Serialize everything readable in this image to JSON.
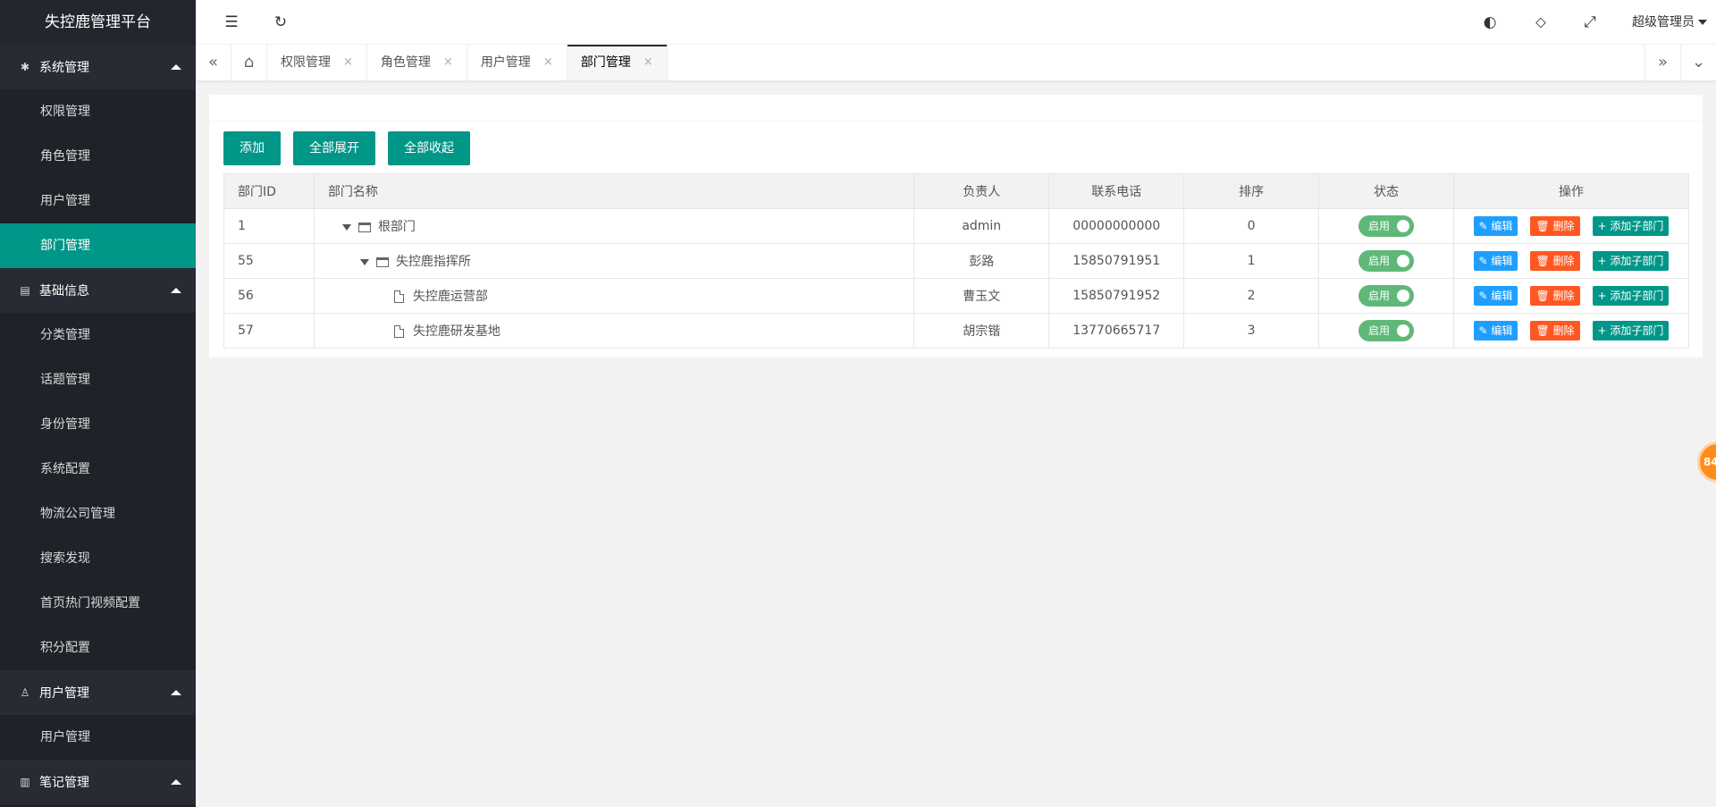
{
  "app_title": "失控鹿管理平台",
  "sidebar": {
    "groups": [
      {
        "label": "系统管理",
        "icon": "gear-icon",
        "items": [
          "权限管理",
          "角色管理",
          "用户管理",
          "部门管理"
        ],
        "active": "部门管理"
      },
      {
        "label": "基础信息",
        "icon": "document-icon",
        "items": [
          "分类管理",
          "话题管理",
          "身份管理",
          "系统配置",
          "物流公司管理",
          "搜索发现",
          "首页热门视频配置",
          "积分配置"
        ]
      },
      {
        "label": "用户管理",
        "icon": "person-icon",
        "items": [
          "用户管理"
        ]
      },
      {
        "label": "笔记管理",
        "icon": "book-icon",
        "items": []
      }
    ]
  },
  "header": {
    "user_name": "超级管理员"
  },
  "tabs": [
    {
      "label": "权限管理"
    },
    {
      "label": "角色管理"
    },
    {
      "label": "用户管理"
    },
    {
      "label": "部门管理",
      "active": true
    }
  ],
  "toolbar": {
    "add_label": "添加",
    "expand_label": "全部展开",
    "collapse_label": "全部收起"
  },
  "table": {
    "columns": [
      "部门ID",
      "部门名称",
      "负责人",
      "联系电话",
      "排序",
      "状态",
      "操作"
    ],
    "rows": [
      {
        "id": "1",
        "name": "根部门",
        "level": 0,
        "type": "folder",
        "leader": "admin",
        "phone": "00000000000",
        "sort": "0",
        "status": "启用"
      },
      {
        "id": "55",
        "name": "失控鹿指挥所",
        "level": 1,
        "type": "folder",
        "leader": "彭路",
        "phone": "15850791951",
        "sort": "1",
        "status": "启用"
      },
      {
        "id": "56",
        "name": "失控鹿运营部",
        "level": 2,
        "type": "file",
        "leader": "曹玉文",
        "phone": "15850791952",
        "sort": "2",
        "status": "启用"
      },
      {
        "id": "57",
        "name": "失控鹿研发基地",
        "level": 2,
        "type": "file",
        "leader": "胡宗锴",
        "phone": "13770665717",
        "sort": "3",
        "status": "启用"
      }
    ],
    "op_edit": "编辑",
    "op_delete": "删除",
    "op_add_child": "添加子部门"
  },
  "floating_badge": "84",
  "colors": {
    "primary": "#009688",
    "sidebar_bg": "#1f2329",
    "edit_blue": "#1e9fff",
    "delete_orange": "#ff5722",
    "switch_green": "#5fb878"
  }
}
